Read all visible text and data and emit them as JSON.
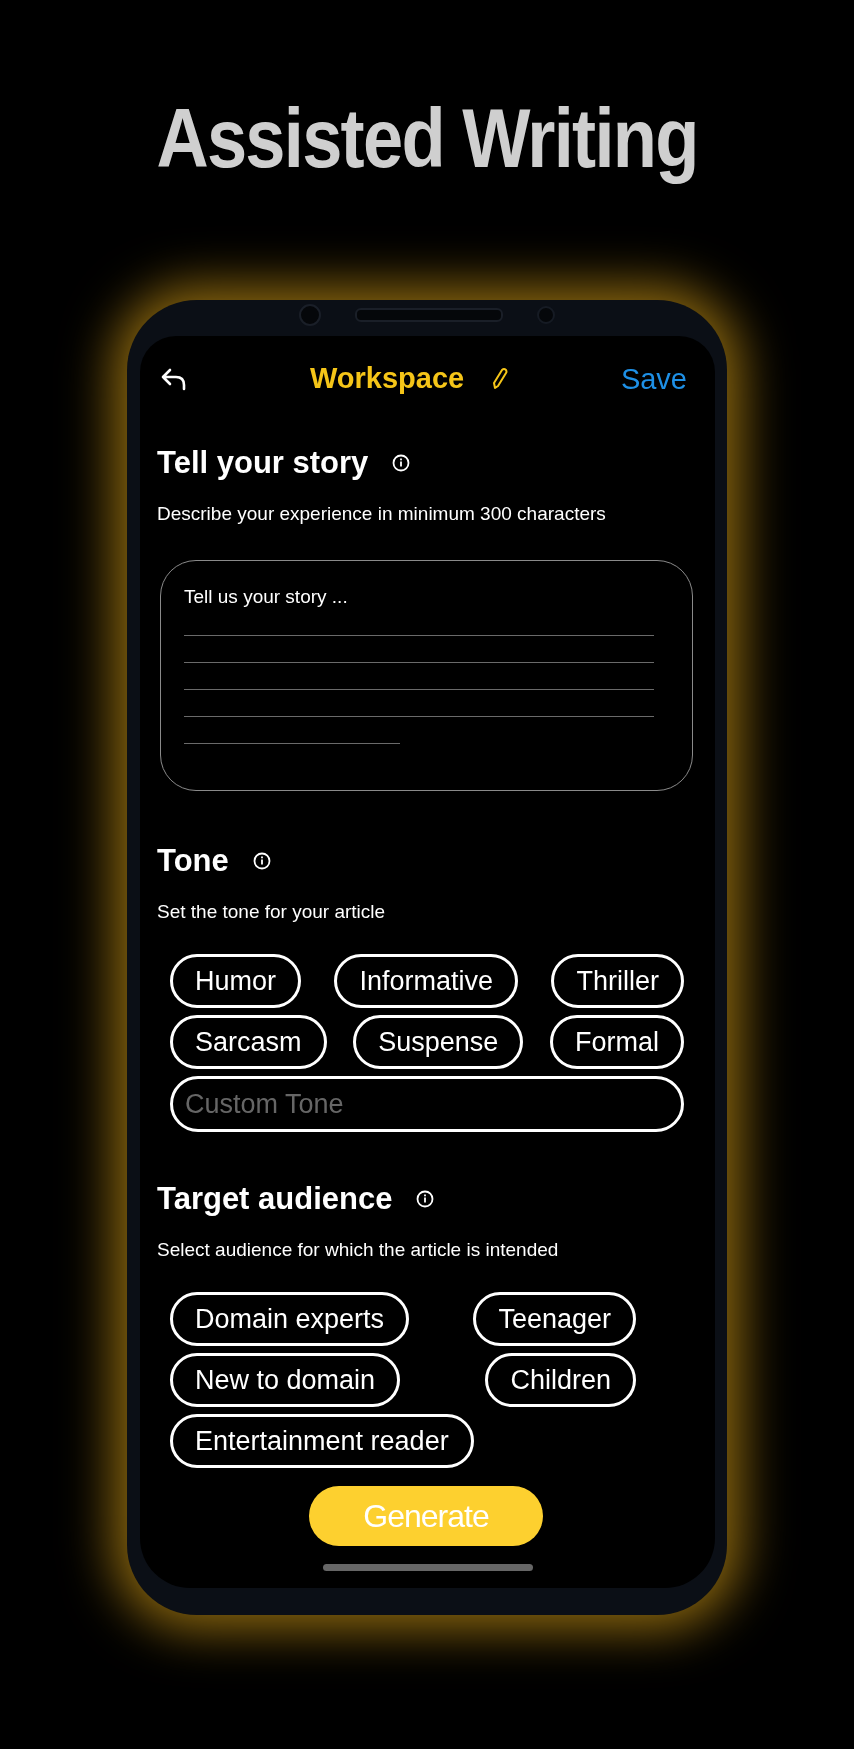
{
  "headline": "Assisted Writing",
  "header": {
    "title": "Workspace",
    "action": "Save"
  },
  "story": {
    "title": "Tell your story",
    "subtitle": "Describe your experience in minimum 300 characters",
    "placeholder": "Tell us your story ..."
  },
  "tone": {
    "title": "Tone",
    "subtitle": "Set the tone for your article",
    "rows": [
      {
        "chips": [
          {
            "label": "Humor",
            "selected": false
          },
          {
            "label": "Informative",
            "selected": false
          },
          {
            "label": "Thriller",
            "selected": false
          }
        ]
      },
      {
        "chips": [
          {
            "label": "Sarcasm",
            "selected": false
          },
          {
            "label": "Suspense",
            "selected": false
          },
          {
            "label": "Formal",
            "selected": false
          }
        ]
      }
    ],
    "custom_placeholder": "Custom Tone"
  },
  "audience": {
    "title": "Target audience",
    "subtitle": "Select audience for which the article is intended",
    "rows": [
      {
        "chips": [
          {
            "label": "Domain experts",
            "selected": false
          },
          {
            "label": "Teenager",
            "selected": false
          }
        ]
      },
      {
        "chips": [
          {
            "label": "New to domain",
            "selected": false
          },
          {
            "label": "Children",
            "selected": false
          }
        ]
      },
      {
        "chips": [
          {
            "label": "Entertainment reader",
            "selected": false
          }
        ]
      }
    ]
  },
  "generate_button": "Generate"
}
